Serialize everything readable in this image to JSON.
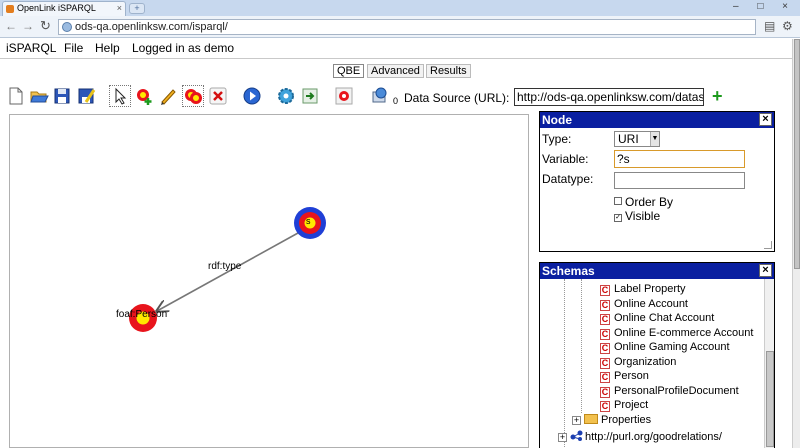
{
  "browser": {
    "tab_title": "OpenLink iSPARQL",
    "tab_close": "×",
    "new_tab": "+",
    "window_controls": "– □ ×",
    "url": "ods-qa.openlinksw.com/isparql/"
  },
  "menu": {
    "app": "iSPARQL",
    "file": "File",
    "help": "Help",
    "login": "Logged in as demo"
  },
  "mode_tabs": [
    "QBE",
    "Advanced",
    "Results"
  ],
  "active_mode_tab": "QBE",
  "toolbar": {
    "data_source_label": "Data Source (URL):",
    "data_source_value": "http://ods-qa.openlinksw.com/dataspace",
    "dataset_count": "0",
    "add_symbol": "+"
  },
  "canvas": {
    "edge_label": "rdf:type",
    "object_node_label": "foaf:Person",
    "subject_node_label": "s"
  },
  "node_panel": {
    "title": "Node",
    "close": "×",
    "type_label": "Type:",
    "type_value": "URI",
    "variable_label": "Variable:",
    "variable_value": "?s",
    "datatype_label": "Datatype:",
    "datatype_value": "",
    "order_by_label": "Order By",
    "order_by_checked": false,
    "visible_label": "Visible",
    "visible_checked": true
  },
  "schemas_panel": {
    "title": "Schemas",
    "close": "×",
    "classes": [
      "Label Property",
      "Online Account",
      "Online Chat Account",
      "Online E-commerce Account",
      "Online Gaming Account",
      "Organization",
      "Person",
      "PersonalProfileDocument",
      "Project"
    ],
    "properties_label": "Properties",
    "next_schema": "http://purl.org/goodrelations/",
    "class_icon_letter": "C",
    "expand_symbol": "+"
  },
  "colors": {
    "panel_title_bg": "#0a1fa0",
    "node_outer_blue": "#1f3fd6",
    "node_red": "#e8141c",
    "node_yellow": "#ffe900",
    "add_green": "#1d9a1d"
  }
}
